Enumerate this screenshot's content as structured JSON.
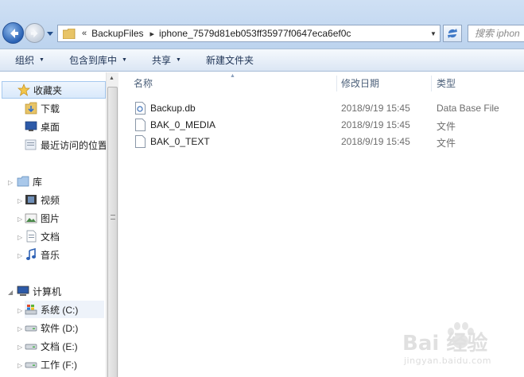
{
  "address": {
    "crumbs_prefix": "«",
    "crumb_1": "BackupFiles",
    "separator": "▸",
    "crumb_2": "iphone_7579d81eb053ff35977f0647eca6ef0c",
    "search_placeholder": "搜索 iphon"
  },
  "toolbar": {
    "organize": "组织",
    "include_in_library": "包含到库中",
    "share": "共享",
    "new_folder": "新建文件夹"
  },
  "navpane": {
    "favorites": {
      "label": "收藏夹",
      "items": [
        {
          "label": "下载",
          "icon": "downloads-icon"
        },
        {
          "label": "桌面",
          "icon": "desktop-icon"
        },
        {
          "label": "最近访问的位置",
          "icon": "recent-places-icon"
        }
      ]
    },
    "libraries": {
      "label": "库",
      "items": [
        {
          "label": "视频",
          "icon": "videos-icon"
        },
        {
          "label": "图片",
          "icon": "pictures-icon"
        },
        {
          "label": "文档",
          "icon": "documents-icon"
        },
        {
          "label": "音乐",
          "icon": "music-icon"
        }
      ]
    },
    "computer": {
      "label": "计算机",
      "items": [
        {
          "label": "系统 (C:)",
          "icon": "system-drive-icon"
        },
        {
          "label": "软件 (D:)",
          "icon": "drive-icon"
        },
        {
          "label": "文档 (E:)",
          "icon": "drive-icon"
        },
        {
          "label": "工作 (F:)",
          "icon": "drive-icon"
        }
      ]
    }
  },
  "columns": {
    "name": "名称",
    "modified": "修改日期",
    "type": "类型"
  },
  "files": [
    {
      "name": "Backup.db",
      "modified": "2018/9/19 15:45",
      "type": "Data Base File"
    },
    {
      "name": "BAK_0_MEDIA",
      "modified": "2018/9/19 15:45",
      "type": "文件"
    },
    {
      "name": "BAK_0_TEXT",
      "modified": "2018/9/19 15:45",
      "type": "文件"
    }
  ],
  "watermark": {
    "brand": "Bai 经验",
    "url": "jingyan.baidu.com"
  }
}
